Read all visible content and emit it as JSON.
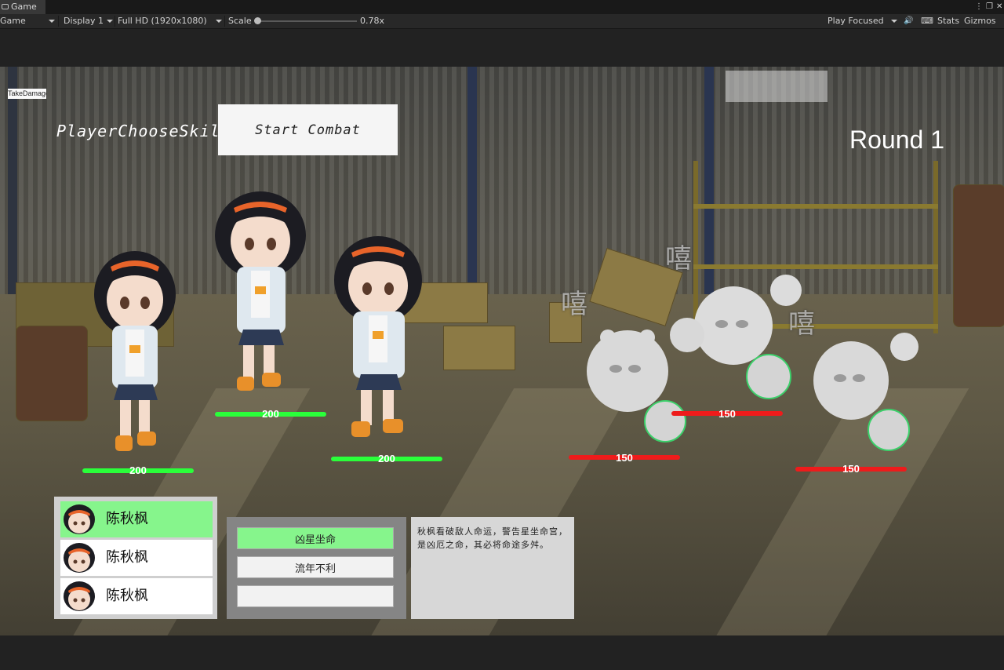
{
  "editor": {
    "tab_label": "Game",
    "toolbar": {
      "view_mode": "Game",
      "display": "Display 1",
      "resolution": "Full HD (1920x1080)",
      "scale_label": "Scale",
      "scale_value": "0.78x",
      "play_mode": "Play Focused",
      "stats": "Stats",
      "gizmos": "Gizmos"
    }
  },
  "hud": {
    "debug_button": "TakeDamage",
    "state_label": "PlayerChooseSkill",
    "start_button": "Start Combat",
    "round_label": "Round 1"
  },
  "players": [
    {
      "hp": "200",
      "hp_color": "#2aff3a"
    },
    {
      "hp": "200",
      "hp_color": "#2aff3a"
    },
    {
      "hp": "200",
      "hp_color": "#2aff3a"
    }
  ],
  "enemies": [
    {
      "hp": "150",
      "hp_color": "#ee1b1b"
    },
    {
      "hp": "150",
      "hp_color": "#ee1b1b"
    },
    {
      "hp": "150",
      "hp_color": "#ee1b1b"
    }
  ],
  "enemy_glyph": "嘻",
  "character_list": [
    {
      "name": "陈秋枫",
      "selected": true
    },
    {
      "name": "陈秋枫",
      "selected": false
    },
    {
      "name": "陈秋枫",
      "selected": false
    }
  ],
  "skills": [
    {
      "label": "凶星坐命",
      "selected": true
    },
    {
      "label": "流年不利",
      "selected": false
    },
    {
      "label": "",
      "selected": false
    }
  ],
  "skill_description": "秋枫看破敌人命运，警告星坐命宫，是凶厄之命，其必将命途多舛。",
  "colors": {
    "selected_green": "#86f58c",
    "player_hp": "#2aff3a",
    "enemy_hp": "#ee1b1b"
  }
}
